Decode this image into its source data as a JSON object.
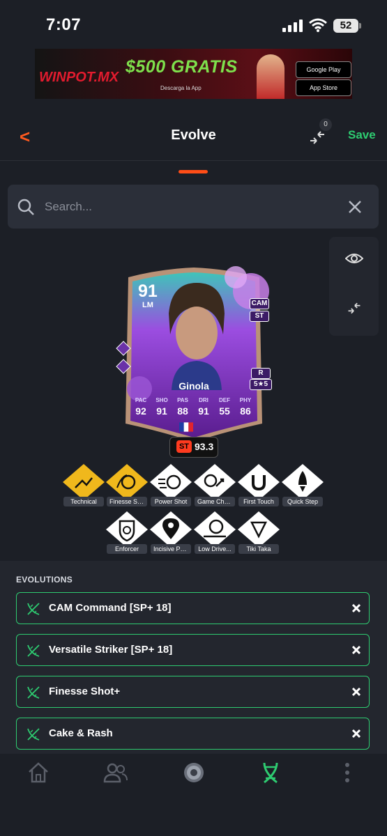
{
  "status_bar": {
    "time": "7:07",
    "battery": "52"
  },
  "ad": {
    "brand": "WINPOT.MX",
    "headline": "$500 GRATIS",
    "subtext": "Descarga la App",
    "store_google": "Google Play",
    "store_apple": "App Store"
  },
  "header": {
    "title": "Evolve",
    "save_label": "Save",
    "compare_count": "0"
  },
  "search": {
    "placeholder": "Search..."
  },
  "card": {
    "rating": "91",
    "position": "LM",
    "alt_positions": [
      "CAM",
      "ST"
    ],
    "foot": "R",
    "skill_stars": "5★5",
    "name": "Ginola",
    "stats": [
      {
        "label": "PAC",
        "value": "92"
      },
      {
        "label": "SHO",
        "value": "91"
      },
      {
        "label": "PAS",
        "value": "88"
      },
      {
        "label": "DRI",
        "value": "91"
      },
      {
        "label": "DEF",
        "value": "55"
      },
      {
        "label": "PHY",
        "value": "86"
      }
    ],
    "badge_position": "ST",
    "badge_rating": "93.3"
  },
  "playstyles": [
    {
      "label": "Technical",
      "plus": true,
      "icon": "technical-icon"
    },
    {
      "label": "Finesse Sh...",
      "plus": true,
      "icon": "finesse-shot-icon"
    },
    {
      "label": "Power Shot",
      "plus": false,
      "icon": "power-shot-icon"
    },
    {
      "label": "Game Cha...",
      "plus": false,
      "icon": "game-changer-icon"
    },
    {
      "label": "First Touch",
      "plus": false,
      "icon": "first-touch-icon"
    },
    {
      "label": "Quick Step",
      "plus": false,
      "icon": "quick-step-icon"
    },
    {
      "label": "Enforcer",
      "plus": false,
      "icon": "enforcer-icon"
    },
    {
      "label": "Incisive Pa...",
      "plus": false,
      "icon": "incisive-pass-icon"
    },
    {
      "label": "Low Drive...",
      "plus": false,
      "icon": "low-driven-shot-icon"
    },
    {
      "label": "Tiki Taka",
      "plus": false,
      "icon": "tiki-taka-icon"
    }
  ],
  "evolutions": {
    "title": "EVOLUTIONS",
    "items": [
      "CAM Command [SP+ 18]",
      "Versatile Striker [SP+ 18]",
      "Finesse Shot+",
      "Cake & Rash"
    ]
  },
  "colors": {
    "accent": "#ff4d17",
    "save": "#2ecc71",
    "gold": "#f0b81c",
    "background": "#1c1f26"
  }
}
